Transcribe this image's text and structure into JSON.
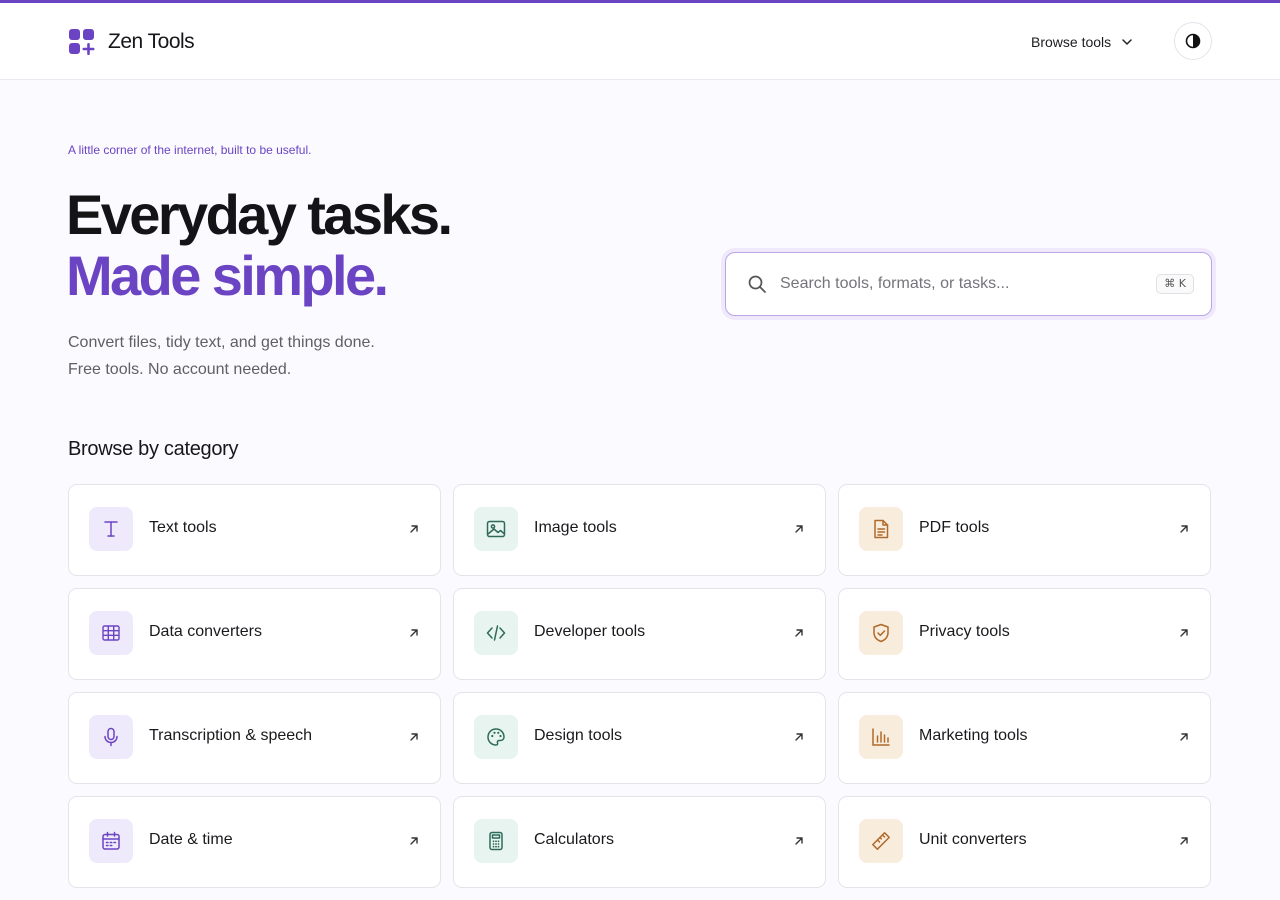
{
  "brand": {
    "name": "Zen Tools"
  },
  "nav": {
    "browse_label": "Browse tools"
  },
  "hero": {
    "tagline": "A little corner of the internet, built to be useful.",
    "line1": "Everyday tasks.",
    "line2": "Made simple.",
    "sub1": "Convert files, tidy text, and get things done.",
    "sub2": "Free tools. No account needed."
  },
  "search": {
    "placeholder": "Search tools, formats, or tasks...",
    "shortcut": "⌘ K"
  },
  "section": {
    "title": "Browse by category"
  },
  "colors": {
    "accent": "#6b44c4",
    "green": "#2e6b5a",
    "orange": "#b06a2a"
  },
  "categories": [
    {
      "label": "Text tools",
      "icon": "text-icon"
    },
    {
      "label": "Image tools",
      "icon": "image-icon"
    },
    {
      "label": "PDF tools",
      "icon": "document-icon"
    },
    {
      "label": "Data converters",
      "icon": "table-icon"
    },
    {
      "label": "Developer tools",
      "icon": "code-icon"
    },
    {
      "label": "Privacy tools",
      "icon": "shield-check-icon"
    },
    {
      "label": "Transcription & speech",
      "icon": "microphone-icon"
    },
    {
      "label": "Design tools",
      "icon": "palette-icon"
    },
    {
      "label": "Marketing tools",
      "icon": "bar-chart-icon"
    },
    {
      "label": "Date & time",
      "icon": "calendar-icon"
    },
    {
      "label": "Calculators",
      "icon": "calculator-icon"
    },
    {
      "label": "Unit converters",
      "icon": "ruler-icon"
    }
  ]
}
